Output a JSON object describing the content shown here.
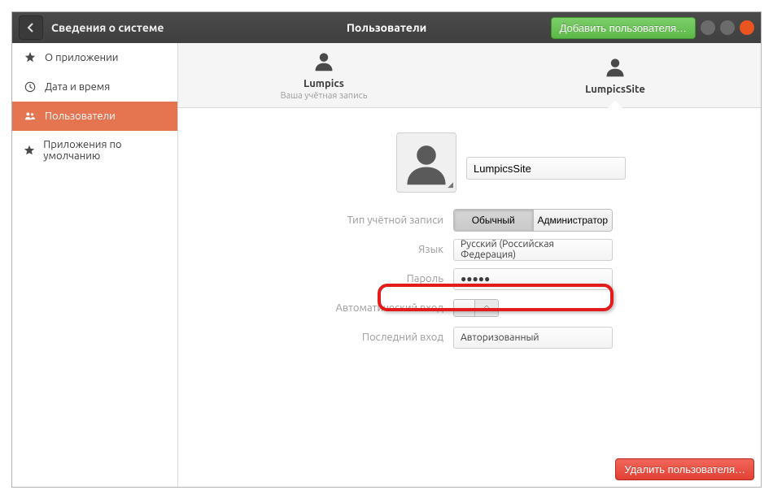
{
  "header": {
    "section_title": "Сведения о системе",
    "window_title": "Пользователи",
    "add_user_label": "Добавить пользователя…"
  },
  "sidebar": {
    "items": [
      {
        "label": "О приложении",
        "icon": "plus-icon",
        "active": false
      },
      {
        "label": "Дата и время",
        "icon": "clock-icon",
        "active": false
      },
      {
        "label": "Пользователи",
        "icon": "users-icon",
        "active": true
      },
      {
        "label": "Приложения по умолчанию",
        "icon": "star-icon",
        "active": false
      }
    ]
  },
  "user_tabs": [
    {
      "name": "Lumpics",
      "subtitle": "Ваша учётная запись",
      "active": false
    },
    {
      "name": "LumpicsSite",
      "subtitle": "",
      "active": true
    }
  ],
  "form": {
    "username_value": "LumpicsSite",
    "account_type_label": "Тип учётной записи",
    "account_type_options": {
      "standard": "Обычный",
      "admin": "Администратор"
    },
    "account_type_selected": "standard",
    "language_label": "Язык",
    "language_value": "Русский (Российская Федерация)",
    "password_label": "Пароль",
    "password_value": "●●●●●",
    "autologin_label": "Автоматический вход",
    "autologin_value": "off",
    "autologin_off_glyph": "○",
    "lastlogin_label": "Последний вход",
    "lastlogin_value": "Авторизованный"
  },
  "footer": {
    "delete_user_label": "Удалить пользователя…"
  }
}
